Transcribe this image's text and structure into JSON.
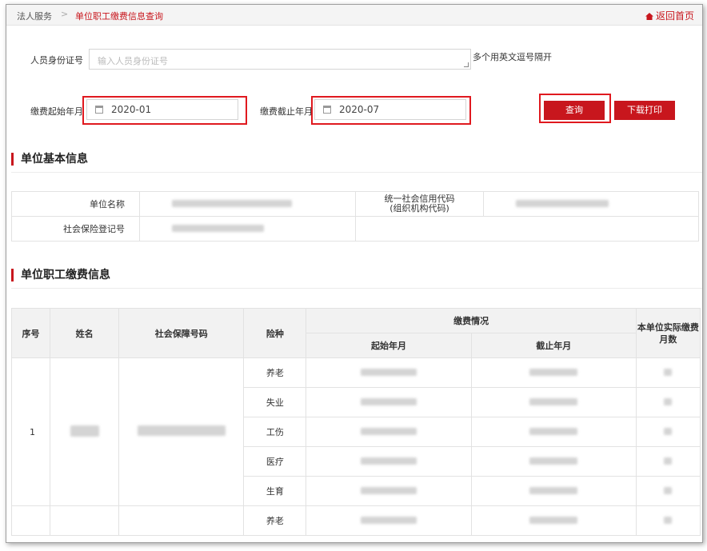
{
  "breadcrumb": {
    "home": "法人服务",
    "separator": ">",
    "current": "单位职工缴费信息查询",
    "back_link": "返回首页",
    "back_icon": "home-icon"
  },
  "form": {
    "id_label": "人员身份证号",
    "id_placeholder": "输入人员身份证号",
    "id_hint": "多个用英文逗号隔开",
    "start_label": "缴费起始年月",
    "start_value": "2020-01",
    "end_label": "缴费截止年月",
    "end_value": "2020-07",
    "query_button": "查询",
    "print_button": "下载打印"
  },
  "unit_info": {
    "title": "单位基本信息",
    "name_label": "单位名称",
    "credit_label_line1": "统一社会信用代码",
    "credit_label_line2": "(组织机构代码)",
    "social_reg_label": "社会保险登记号"
  },
  "payment": {
    "title": "单位职工缴费信息",
    "headers": {
      "seq": "序号",
      "name": "姓名",
      "ss_no": "社会保障号码",
      "type": "险种",
      "pay_status": "缴费情况",
      "start": "起始年月",
      "end": "截止年月",
      "months_line1": "本单位实际缴费",
      "months_line2": "月数"
    },
    "row_seq": "1",
    "types": [
      "养老",
      "失业",
      "工伤",
      "医疗",
      "生育",
      "养老"
    ]
  },
  "colors": {
    "accent": "#c8161d",
    "highlight_frame": "#e0191f"
  }
}
